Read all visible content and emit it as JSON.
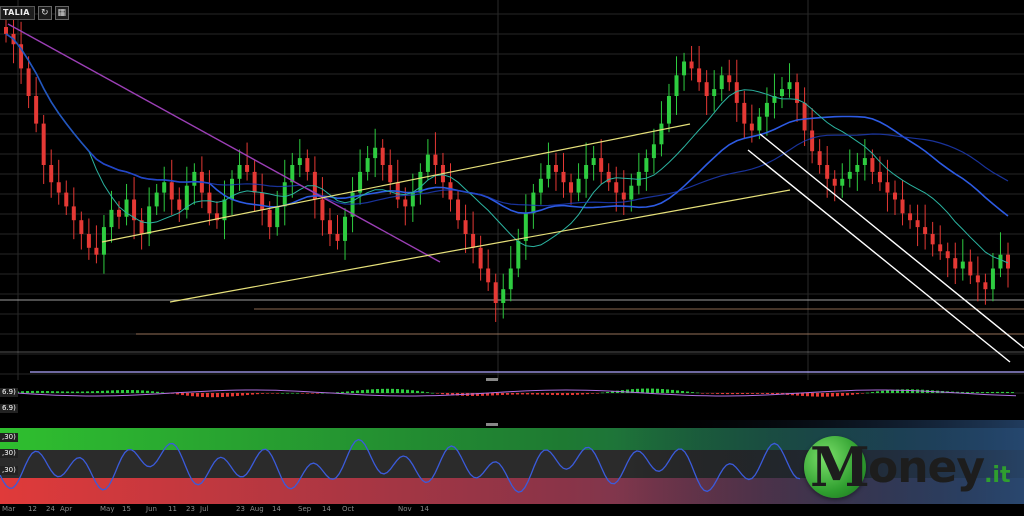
{
  "toolbar": {
    "symbol": "TALIA",
    "refresh_icon": "refresh-icon",
    "calendar_icon": "calendar-icon"
  },
  "panels": {
    "macd_label_1": "6.9)",
    "macd_label_2": "6.9)",
    "osc_label_1": ",30)",
    "osc_label_2": ",30)",
    "osc_label_3": ",30)"
  },
  "x_axis": {
    "ticks": [
      "Mar",
      "12",
      "24",
      "Apr",
      "May",
      "15",
      "Jun",
      "11",
      "23",
      "Jul",
      "23",
      "Aug",
      "14",
      "Sep",
      "14",
      "Oct",
      "Nov",
      "14"
    ]
  },
  "logo": {
    "m": "M",
    "rest": "oney",
    "suffix": ".it"
  },
  "colors": {
    "bull": "#2ecc40",
    "bear": "#e53935",
    "ma_blue": "#2d5be3",
    "ma_teal": "#2bb3a0",
    "ma_purple": "#9b3fb5",
    "channel_yellow": "#e6e07a",
    "channel_white": "#ffffff",
    "osc_line": "#3b5bdb"
  },
  "chart_data": {
    "type": "candlestick",
    "title": "",
    "xlabel": "",
    "ylabel": "",
    "series": [
      {
        "name": "",
        "values": [
          98,
          95,
          88,
          80,
          72,
          60,
          55,
          52,
          48,
          44,
          40,
          36,
          34,
          42,
          47,
          45,
          50,
          44,
          40,
          48,
          52,
          55,
          50,
          47,
          54,
          58,
          52,
          46,
          44,
          50,
          56,
          60,
          58,
          52,
          47,
          42,
          48,
          55,
          60,
          62,
          58,
          50,
          44,
          40,
          38,
          45,
          52,
          58,
          62,
          65,
          60,
          55,
          50,
          48,
          52,
          58,
          63,
          60,
          55,
          50,
          44,
          40,
          36,
          30,
          26,
          20,
          24,
          30,
          38,
          46,
          52,
          56,
          60,
          58,
          55,
          52,
          56,
          60,
          62,
          58,
          55,
          52,
          50,
          54,
          58,
          62,
          66,
          72,
          80,
          86,
          90,
          88,
          84,
          80,
          82,
          86,
          84,
          78,
          72,
          70,
          74,
          78,
          80,
          82,
          84,
          78,
          70,
          64,
          60,
          56,
          54,
          56,
          58,
          60,
          62,
          58,
          55,
          52,
          50,
          46,
          44,
          42,
          40,
          37,
          35,
          33,
          30,
          32,
          28,
          26,
          24,
          30,
          34,
          30
        ]
      }
    ]
  }
}
